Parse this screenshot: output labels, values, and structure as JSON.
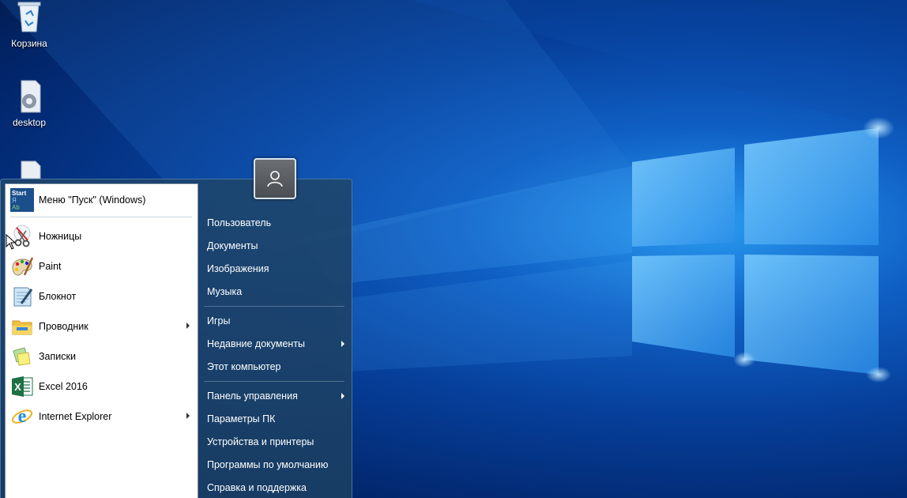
{
  "desktop": {
    "icons": [
      {
        "label": "Корзина"
      },
      {
        "label": "desktop"
      },
      {
        "label": ""
      }
    ]
  },
  "start_menu": {
    "programs": [
      {
        "label": "Меню \"Пуск\" (Windows)",
        "icon": "start-menu-icon",
        "has_submenu": false
      },
      {
        "label": "Ножницы",
        "icon": "scissors-icon",
        "has_submenu": false
      },
      {
        "label": "Paint",
        "icon": "paint-icon",
        "has_submenu": false
      },
      {
        "label": "Блокнот",
        "icon": "notepad-icon",
        "has_submenu": false
      },
      {
        "label": "Проводник",
        "icon": "folder-icon",
        "has_submenu": true
      },
      {
        "label": "Записки",
        "icon": "sticky-notes-icon",
        "has_submenu": false
      },
      {
        "label": "Excel 2016",
        "icon": "excel-icon",
        "has_submenu": false
      },
      {
        "label": "Internet Explorer",
        "icon": "internet-explorer-icon",
        "has_submenu": true
      }
    ],
    "start_icon_text": {
      "line1": "Start",
      "line2": "Я",
      "line3": "Ab"
    },
    "excel_letter": "X",
    "ie_letter": "e",
    "right_items": [
      {
        "label": "Пользователь",
        "has_submenu": false
      },
      {
        "label": "Документы",
        "has_submenu": false
      },
      {
        "label": "Изображения",
        "has_submenu": false
      },
      {
        "label": "Музыка",
        "has_submenu": false
      },
      {
        "label": "Игры",
        "has_submenu": false
      },
      {
        "label": "Недавние документы",
        "has_submenu": true
      },
      {
        "label": "Этот компьютер",
        "has_submenu": false
      },
      {
        "label": "Панель управления",
        "has_submenu": true
      },
      {
        "label": "Параметры ПК",
        "has_submenu": false
      },
      {
        "label": "Устройства и принтеры",
        "has_submenu": false
      },
      {
        "label": "Программы по умолчанию",
        "has_submenu": false
      },
      {
        "label": "Справка и поддержка",
        "has_submenu": false
      }
    ]
  },
  "colors": {
    "accent": "#0f5fc4",
    "menu_right_bg": "#1e466e",
    "excel_green": "#1e7145",
    "ie_blue": "#1f8fd8"
  }
}
